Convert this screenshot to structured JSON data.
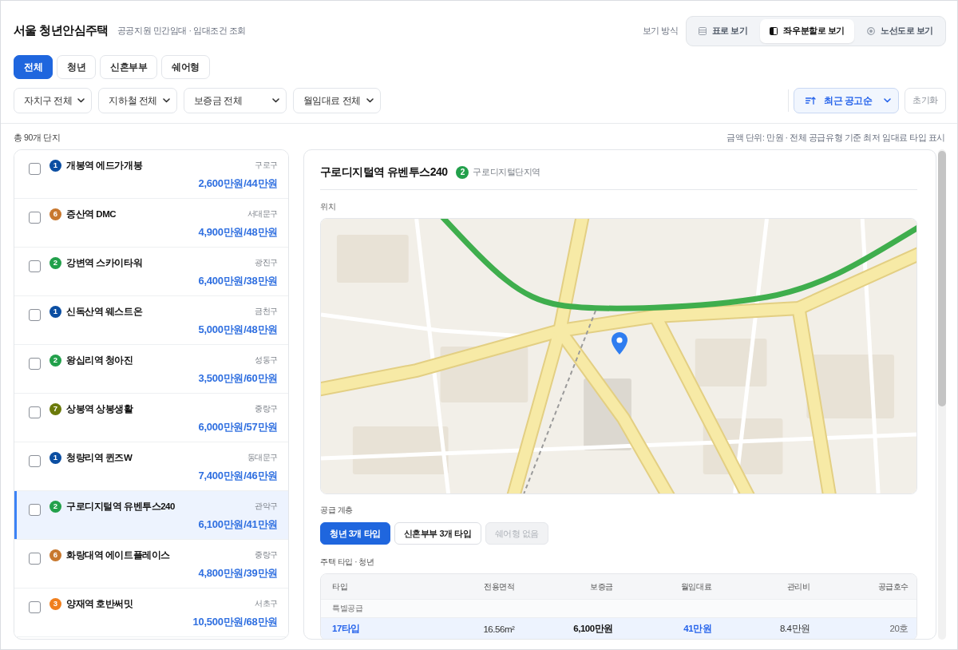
{
  "header": {
    "title": "서울 청년안심주택",
    "subtitle": "공공지원 민간임대 · 임대조건 조회"
  },
  "view_mode": {
    "label": "보기 방식",
    "options": [
      {
        "kind": "table",
        "label": "표로 보기",
        "selected": false
      },
      {
        "kind": "split",
        "label": "좌우분할로 보기",
        "selected": true
      },
      {
        "kind": "route",
        "label": "노선도로 보기",
        "selected": false
      }
    ]
  },
  "category_tabs": [
    {
      "label": "전체",
      "selected": true
    },
    {
      "label": "청년",
      "selected": false
    },
    {
      "label": "신혼부부",
      "selected": false
    },
    {
      "label": "쉐어형",
      "selected": false
    }
  ],
  "filters": [
    "자치구 전체",
    "지하철 전체",
    "보증금 전체",
    "월임대료 전체"
  ],
  "sort": {
    "label": "최근 공고순"
  },
  "reset_button": "초기화",
  "summary": {
    "count": "총 90개 단지",
    "note": "금액 단위: 만원 · 전체 공급유형 기준 최저 임대료 타입 표시"
  },
  "complexes": [
    {
      "line": "1",
      "color": "#0b4ea2",
      "name": "개봉역 에드가개봉",
      "district": "구로구",
      "price": "2,600만원/44만원",
      "checked": false,
      "selected": false
    },
    {
      "line": "6",
      "color": "#c8782e",
      "name": "증산역 DMC",
      "district": "서대문구",
      "price": "4,900만원/48만원",
      "checked": false,
      "selected": false
    },
    {
      "line": "2",
      "color": "#22a04b",
      "name": "강변역 스카이타워",
      "district": "광진구",
      "price": "6,400만원/38만원",
      "checked": false,
      "selected": false
    },
    {
      "line": "1",
      "color": "#0b4ea2",
      "name": "신독산역 웨스트온",
      "district": "금천구",
      "price": "5,000만원/48만원",
      "checked": false,
      "selected": false
    },
    {
      "line": "2",
      "color": "#22a04b",
      "name": "왕십리역 청아진",
      "district": "성동구",
      "price": "3,500만원/60만원",
      "checked": false,
      "selected": false
    },
    {
      "line": "7",
      "color": "#6b7a0a",
      "name": "상봉역 상봉생활",
      "district": "중랑구",
      "price": "6,000만원/57만원",
      "checked": false,
      "selected": false
    },
    {
      "line": "1",
      "color": "#0b4ea2",
      "name": "청량리역 퀸즈W",
      "district": "동대문구",
      "price": "7,400만원/46만원",
      "checked": false,
      "selected": false
    },
    {
      "line": "2",
      "color": "#22a04b",
      "name": "구로디지털역 유벤투스240",
      "district": "관악구",
      "price": "6,100만원/41만원",
      "checked": false,
      "selected": true
    },
    {
      "line": "6",
      "color": "#c8782e",
      "name": "화랑대역 에이트플레이스",
      "district": "중랑구",
      "price": "4,800만원/39만원",
      "checked": false,
      "selected": false
    },
    {
      "line": "3",
      "color": "#f07f1d",
      "name": "양재역 호반써밋",
      "district": "서초구",
      "price": "10,500만원/68만원",
      "checked": false,
      "selected": false
    }
  ],
  "detail": {
    "name": "구로디지털역 유벤투스240",
    "line": "2",
    "color": "#22a04b",
    "station": "구로디지털단지역",
    "location_label": "위치",
    "supply_label": "공급 계층",
    "supply_tabs": [
      {
        "label": "청년 3개 타입",
        "selected": true,
        "disabled": false
      },
      {
        "label": "신혼부부 3개 타입",
        "selected": false,
        "disabled": false
      },
      {
        "label": "쉐어형 없음",
        "selected": false,
        "disabled": true
      }
    ],
    "table_label": "주택 타입 · 청년",
    "table": {
      "columns": [
        "타입",
        "전용면적",
        "보증금",
        "월임대료",
        "관리비",
        "공급호수"
      ],
      "groups": [
        {
          "label": "특별공급",
          "rows": [
            {
              "highlighted": true,
              "cells": [
                "17타입",
                "16.56m²",
                "6,100만원",
                "41만원",
                "8.4만원",
                "20호"
              ]
            }
          ]
        }
      ]
    }
  }
}
